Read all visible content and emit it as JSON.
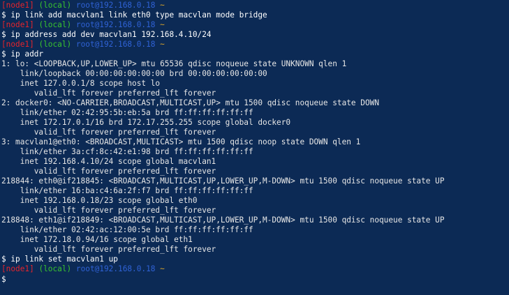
{
  "colors": {
    "background": "#0c2a55",
    "node": "#e5242c",
    "local": "#39c42e",
    "user": "#2f62d6",
    "tilde": "#d9a52a",
    "text": "#e6e6e6"
  },
  "lines": [
    {
      "kind": "prompt",
      "node": "[node1]",
      "local": "(local)",
      "user": "root@192.168.0.18",
      "tilde": "~"
    },
    {
      "kind": "command",
      "text": "$ ip link add macvlan1 link eth0 type macvlan mode bridge"
    },
    {
      "kind": "prompt",
      "node": "[node1]",
      "local": "(local)",
      "user": "root@192.168.0.18",
      "tilde": "~"
    },
    {
      "kind": "command",
      "text": "$ ip address add dev macvlan1 192.168.4.10/24"
    },
    {
      "kind": "prompt",
      "node": "[node1]",
      "local": "(local)",
      "user": "root@192.168.0.18",
      "tilde": "~"
    },
    {
      "kind": "command",
      "text": "$ ip addr"
    },
    {
      "kind": "output",
      "text": "1: lo: <LOOPBACK,UP,LOWER_UP> mtu 65536 qdisc noqueue state UNKNOWN qlen 1"
    },
    {
      "kind": "output",
      "text": "    link/loopback 00:00:00:00:00:00 brd 00:00:00:00:00:00"
    },
    {
      "kind": "output",
      "text": "    inet 127.0.0.1/8 scope host lo"
    },
    {
      "kind": "output",
      "text": "       valid_lft forever preferred_lft forever"
    },
    {
      "kind": "output",
      "text": "2: docker0: <NO-CARRIER,BROADCAST,MULTICAST,UP> mtu 1500 qdisc noqueue state DOWN"
    },
    {
      "kind": "output",
      "text": "    link/ether 02:42:95:5b:eb:5a brd ff:ff:ff:ff:ff:ff"
    },
    {
      "kind": "output",
      "text": "    inet 172.17.0.1/16 brd 172.17.255.255 scope global docker0"
    },
    {
      "kind": "output",
      "text": "       valid_lft forever preferred_lft forever"
    },
    {
      "kind": "output",
      "text": "3: macvlan1@eth0: <BROADCAST,MULTICAST> mtu 1500 qdisc noop state DOWN qlen 1"
    },
    {
      "kind": "output",
      "text": "    link/ether 3a:cf:8c:42:e1:98 brd ff:ff:ff:ff:ff:ff"
    },
    {
      "kind": "output",
      "text": "    inet 192.168.4.10/24 scope global macvlan1"
    },
    {
      "kind": "output",
      "text": "       valid_lft forever preferred_lft forever"
    },
    {
      "kind": "output",
      "text": "218844: eth0@if218845: <BROADCAST,MULTICAST,UP,LOWER_UP,M-DOWN> mtu 1500 qdisc noqueue state UP"
    },
    {
      "kind": "output",
      "text": "    link/ether 16:ba:c4:6a:2f:f7 brd ff:ff:ff:ff:ff:ff"
    },
    {
      "kind": "output",
      "text": "    inet 192.168.0.18/23 scope global eth0"
    },
    {
      "kind": "output",
      "text": "       valid_lft forever preferred_lft forever"
    },
    {
      "kind": "output",
      "text": "218848: eth1@if218849: <BROADCAST,MULTICAST,UP,LOWER_UP,M-DOWN> mtu 1500 qdisc noqueue state UP"
    },
    {
      "kind": "output",
      "text": "    link/ether 02:42:ac:12:00:5e brd ff:ff:ff:ff:ff:ff"
    },
    {
      "kind": "output",
      "text": "    inet 172.18.0.94/16 scope global eth1"
    },
    {
      "kind": "output",
      "text": "       valid_lft forever preferred_lft forever"
    },
    {
      "kind": "command",
      "text": "$ ip link set macvlan1 up"
    },
    {
      "kind": "prompt",
      "node": "[node1]",
      "local": "(local)",
      "user": "root@192.168.0.18",
      "tilde": "~"
    },
    {
      "kind": "input",
      "text": "$ "
    }
  ]
}
